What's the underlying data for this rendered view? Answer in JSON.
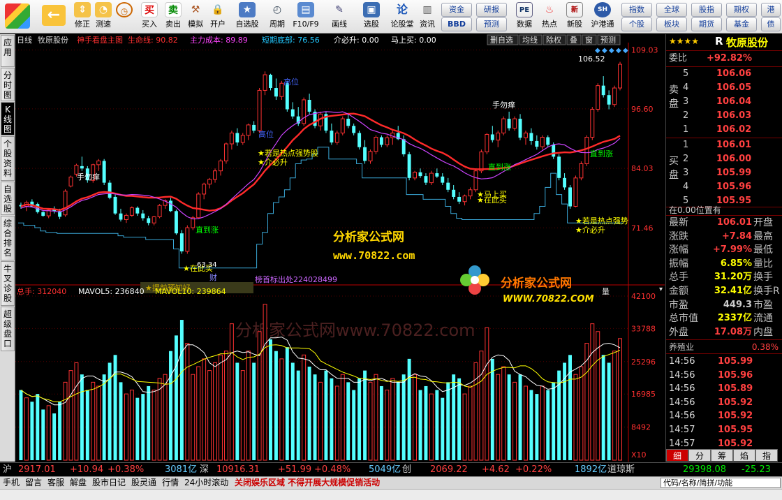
{
  "toolbar": {
    "left": [
      "",
      "修正",
      "测速"
    ],
    "mid": [
      "买入",
      "卖出",
      "模拟",
      "开户"
    ],
    "right": [
      "自选股",
      "周期",
      "F10/F9",
      "画线",
      "选股",
      "论股堂",
      "资讯"
    ],
    "r2": [
      "数据",
      "热点",
      "新股",
      "沪港通"
    ],
    "g1": [
      "资金",
      "BBD"
    ],
    "g2": [
      "研报",
      "预测"
    ],
    "g3": [
      "指数",
      "个股"
    ],
    "g4": [
      "全球",
      "板块"
    ],
    "g5": [
      "股指",
      "期货"
    ],
    "g6": [
      "期权",
      "基金"
    ],
    "g7": [
      "港",
      "债"
    ]
  },
  "left_tabs": [
    "应用",
    "分时图",
    "K线图",
    "个股资料",
    "自选股",
    "综合排名",
    "牛叉诊股",
    "超级盘口"
  ],
  "chart_header": {
    "period": "日线",
    "name": "牧原股份",
    "formula": "神手看盘主图",
    "f1": "生命线: 90.82",
    "f2": "主力成本: 89.89",
    "f3": "短期底部: 76.56",
    "f4": "介必升: 0.00",
    "f5": "马上买: 0.00",
    "buttons": [
      "删自选",
      "均线",
      "除权",
      "叠",
      "窗",
      "预测"
    ]
  },
  "price_axis": [
    "109.03",
    "96.60",
    "84.03",
    "71.46"
  ],
  "vol_axis": [
    "42100",
    "33788",
    "25296",
    "16985",
    "8492",
    "X10"
  ],
  "annotations": {
    "a1": "手勿痒",
    "a2": "高位",
    "a3": "高位",
    "a4": "★若是热点强势股",
    "a5": "★介必升",
    "a6": "直到涨",
    "a7": "直到涨",
    "a8": "手勿痒",
    "a9": "直到涨",
    "a10": "★马上买",
    "a11": "★在此买",
    "a12": "★若是热点强势",
    "a13": "★介必升",
    "a14": "★在此买",
    "a15": "63.34",
    "a16": "106.52",
    "a17": "财",
    "a18": "榜首标出处224028499",
    "a19": "★提前预知好"
  },
  "watermark": {
    "t1": "分析家公式网",
    "t2": "www.70822.com",
    "t3": "分析家公式网www.70822.com",
    "logo1": "分析家公式网",
    "logo2": "WWW.70822.COM"
  },
  "volume_header": {
    "total": "总手: 312040",
    "m5": "MAVOL5: 236840",
    "m10": "MAVOL10: 239864",
    "btn": "量"
  },
  "quote": {
    "stars": "★★★★",
    "rflag": "R",
    "name": "牧原股份",
    "ratio_label": "委比",
    "ratio": "+92.82%",
    "sell_label": [
      "卖",
      "盘"
    ],
    "buy_label": [
      "买",
      "盘"
    ],
    "sell": [
      [
        "5",
        "106.06"
      ],
      [
        "4",
        "106.05"
      ],
      [
        "3",
        "106.04"
      ],
      [
        "2",
        "106.03"
      ],
      [
        "1",
        "106.02"
      ]
    ],
    "buy": [
      [
        "1",
        "106.01"
      ],
      [
        "2",
        "106.00"
      ],
      [
        "3",
        "105.99"
      ],
      [
        "4",
        "105.96"
      ],
      [
        "5",
        "105.95"
      ]
    ],
    "pos": "在0.00位置有",
    "stats": [
      [
        "最新",
        "106.01",
        "开盘"
      ],
      [
        "涨跌",
        "+7.84",
        "最高"
      ],
      [
        "涨幅",
        "+7.99%",
        "最低"
      ],
      [
        "振幅",
        "6.85%",
        "量比"
      ],
      [
        "总手",
        "31.20万",
        "换手"
      ],
      [
        "金额",
        "32.41亿",
        "换手R"
      ],
      [
        "市盈",
        "449.3",
        "市盈"
      ],
      [
        "总市值",
        "2337亿",
        "流通"
      ],
      [
        "外盘",
        "17.08万",
        "内盘"
      ]
    ],
    "industry": "养殖业",
    "industry_pct": "0.38%",
    "ticks": [
      [
        "14:56",
        "105.99"
      ],
      [
        "14:56",
        "105.96"
      ],
      [
        "14:56",
        "105.89"
      ],
      [
        "14:56",
        "105.92"
      ],
      [
        "14:56",
        "105.92"
      ],
      [
        "14:57",
        "105.95"
      ],
      [
        "14:57",
        "105.92"
      ],
      [
        "15:00",
        "106.01"
      ]
    ],
    "tabs": [
      "细",
      "分",
      "筹",
      "焰",
      "指"
    ]
  },
  "status": {
    "sh": "沪",
    "sh_v": "2917.01",
    "sh_c": "+10.94",
    "sh_p": "+0.38%",
    "sh_a": "3081亿",
    "sz": "深",
    "sz_v": "10916.31",
    "sz_c": "+51.99",
    "sz_p": "+0.48%",
    "sz_a": "5049亿",
    "cy": "创",
    "cy_v": "2069.22",
    "cy_c": "+4.62",
    "cy_p": "+0.22%",
    "cy_a": "1892亿",
    "dj": "道琼斯",
    "dj_v": "29398.08",
    "dj_c": "-25.23"
  },
  "sbar": {
    "items": [
      "手机",
      "留言",
      "客服",
      "解盘",
      "股市日记",
      "股灵通",
      "行情",
      "24小时滚动"
    ],
    "news": "关闭娱乐区域  不得开展大规模促销活动",
    "search": "代码/名称/简拼/功能"
  },
  "chart_data": {
    "type": "candlestick",
    "price_range": [
      60,
      110
    ],
    "vol_range": [
      0,
      42100
    ],
    "ohlc": [
      [
        76.3,
        76.8,
        75.5,
        76
      ],
      [
        76,
        77.2,
        75,
        76.8
      ],
      [
        77,
        77.5,
        75.8,
        76
      ],
      [
        76.5,
        76.8,
        74.5,
        74.8
      ],
      [
        74.8,
        75,
        73.8,
        74
      ],
      [
        74,
        75.5,
        73.5,
        75.2
      ],
      [
        75.5,
        76,
        74.5,
        75
      ],
      [
        75,
        75.5,
        73.3,
        73.8
      ],
      [
        74.2,
        79.6,
        73.8,
        79.2
      ],
      [
        80.3,
        82.5,
        80,
        82.2
      ],
      [
        82.8,
        85,
        82.3,
        84.7
      ],
      [
        84.5,
        86.5,
        83.5,
        84
      ],
      [
        84,
        84.5,
        81,
        81.5
      ],
      [
        81.5,
        85,
        81,
        84.8
      ],
      [
        84.8,
        86,
        83.5,
        85.6
      ],
      [
        85.6,
        86,
        80.5,
        81
      ],
      [
        81,
        81.5,
        77.5,
        77.8
      ],
      [
        78,
        78.5,
        74.2,
        74.5
      ],
      [
        74.5,
        75.5,
        72.8,
        73.2
      ],
      [
        73.2,
        74.5,
        72.5,
        74.1
      ],
      [
        74.1,
        76,
        73.8,
        75.7
      ],
      [
        75.7,
        76,
        74,
        74.5
      ],
      [
        74.5,
        75.2,
        73,
        73.5
      ],
      [
        73.5,
        74,
        72,
        72.5
      ],
      [
        72.5,
        74,
        72,
        73.8
      ],
      [
        73.8,
        76.5,
        73.5,
        76.2
      ],
      [
        76.2,
        77.5,
        75.5,
        77.2
      ],
      [
        77.2,
        77.8,
        74.8,
        75
      ],
      [
        75,
        75.3,
        70,
        70.3
      ],
      [
        70.3,
        71,
        66,
        66.5
      ],
      [
        66.5,
        72,
        66,
        71.5
      ],
      [
        71.5,
        74,
        71,
        73.6
      ],
      [
        73.6,
        79,
        73.5,
        78.6
      ],
      [
        78.6,
        81,
        77.5,
        80.7
      ],
      [
        80.7,
        82,
        79.8,
        81.7
      ],
      [
        81.7,
        84,
        81,
        83.5
      ],
      [
        83.5,
        86,
        82.5,
        85.6
      ],
      [
        85.6,
        89.5,
        85,
        89.2
      ],
      [
        89.2,
        92,
        88,
        91.5
      ],
      [
        91.5,
        92.5,
        88.8,
        89.5
      ],
      [
        89.5,
        91.5,
        89,
        91
      ],
      [
        91,
        93.5,
        90,
        93.2
      ],
      [
        93.2,
        94,
        91.5,
        92
      ],
      [
        92,
        101,
        91.5,
        100.5
      ],
      [
        100.5,
        104.5,
        99.5,
        103.8
      ],
      [
        103.8,
        104,
        100.5,
        101
      ],
      [
        101,
        103,
        98.5,
        99.2
      ],
      [
        99.2,
        102.5,
        98.5,
        102
      ],
      [
        102,
        102.5,
        96,
        96.5
      ],
      [
        96.5,
        98,
        94.5,
        95
      ],
      [
        95,
        97,
        93,
        93.5
      ],
      [
        93.5,
        99,
        93,
        98.5
      ],
      [
        98.5,
        99.8,
        95.5,
        96
      ],
      [
        96,
        96.5,
        92.5,
        93
      ],
      [
        93,
        96,
        92,
        95.5
      ],
      [
        95.5,
        96,
        91.5,
        92
      ],
      [
        92,
        93.5,
        89,
        89.5
      ],
      [
        89.5,
        92,
        89,
        91.5
      ],
      [
        91.5,
        95,
        91,
        94.5
      ],
      [
        94.5,
        95.5,
        92.5,
        93
      ],
      [
        93,
        93.5,
        91,
        91.5
      ],
      [
        91.5,
        92,
        88,
        88.5
      ],
      [
        88.5,
        90,
        85,
        85.6
      ],
      [
        85.6,
        88,
        85,
        87.6
      ],
      [
        87.6,
        91,
        87,
        90.6
      ],
      [
        90.6,
        91,
        88.5,
        89
      ],
      [
        89,
        91,
        88.5,
        90.5
      ],
      [
        90.5,
        92,
        89,
        91.5
      ],
      [
        91.5,
        93,
        90,
        90.2
      ],
      [
        90.2,
        91,
        86.5,
        87
      ],
      [
        87,
        87.5,
        81.5,
        82
      ],
      [
        82,
        83.5,
        81.5,
        83.2
      ],
      [
        83.2,
        84,
        82,
        82.4
      ],
      [
        82.4,
        83,
        80.5,
        81
      ],
      [
        81,
        83.5,
        80.5,
        83
      ],
      [
        83,
        84,
        82,
        82.3
      ],
      [
        82.3,
        83,
        80.5,
        81
      ],
      [
        81,
        82,
        79,
        79.5
      ],
      [
        79.5,
        80.5,
        77.5,
        78
      ],
      [
        78,
        79,
        76.5,
        77
      ],
      [
        77,
        78.5,
        76.2,
        78.2
      ],
      [
        78.2,
        80,
        77.5,
        79.5
      ],
      [
        79.5,
        84,
        79,
        83.5
      ],
      [
        83.5,
        88,
        83,
        87.5
      ],
      [
        87.5,
        91.5,
        87,
        91.2
      ],
      [
        91.2,
        93,
        89.5,
        90
      ],
      [
        90,
        92,
        88.5,
        91.5
      ],
      [
        91.5,
        95,
        91,
        94.5
      ],
      [
        94.5,
        96,
        92,
        92.5
      ],
      [
        92.5,
        95,
        92,
        94.5
      ],
      [
        94.5,
        95.5,
        90,
        90.5
      ],
      [
        90.5,
        92,
        89,
        91.5
      ],
      [
        91.5,
        92.5,
        89,
        89.8
      ],
      [
        89.8,
        91,
        88,
        88.6
      ],
      [
        88.6,
        91,
        88,
        90.6
      ],
      [
        90.6,
        91,
        88.5,
        89
      ],
      [
        89,
        89.5,
        86,
        86.5
      ],
      [
        86.5,
        87,
        81.5,
        82
      ],
      [
        82,
        83,
        79.5,
        80
      ],
      [
        80,
        80.5,
        75.5,
        76
      ],
      [
        76,
        82.5,
        75.8,
        82
      ],
      [
        82,
        85.5,
        81.5,
        85
      ],
      [
        85,
        91,
        84.5,
        90.6
      ],
      [
        90.6,
        97,
        90,
        96.5
      ],
      [
        96.5,
        102,
        96,
        101.5
      ],
      [
        101.5,
        103.5,
        99,
        99.5
      ],
      [
        99.5,
        100.5,
        96.5,
        97.5
      ],
      [
        97.5,
        101.5,
        97,
        101
      ],
      [
        101,
        106.52,
        100.5,
        106.01
      ]
    ],
    "volume": [
      18,
      16,
      15,
      17,
      13,
      14,
      12,
      15,
      20,
      23,
      25,
      22,
      18,
      20,
      19,
      22,
      25,
      27,
      20,
      17,
      18,
      16,
      17,
      19,
      18,
      21,
      22,
      28,
      32,
      36,
      30,
      22,
      24,
      26,
      23,
      25,
      27,
      28,
      35,
      25,
      23,
      28,
      25,
      33,
      40,
      31,
      28,
      26,
      29,
      25,
      23,
      27,
      24,
      22,
      20,
      23,
      21,
      19,
      22,
      20,
      18,
      21,
      23,
      20,
      22,
      19,
      18,
      21,
      20,
      22,
      26,
      22,
      18,
      19,
      17,
      18,
      16,
      20,
      22,
      21,
      17,
      19,
      25,
      28,
      34,
      26,
      22,
      24,
      22,
      20,
      22,
      19,
      18,
      17,
      19,
      18,
      20,
      23,
      25,
      27,
      22,
      24,
      30,
      35,
      33,
      27,
      25,
      28,
      31.2
    ]
  }
}
